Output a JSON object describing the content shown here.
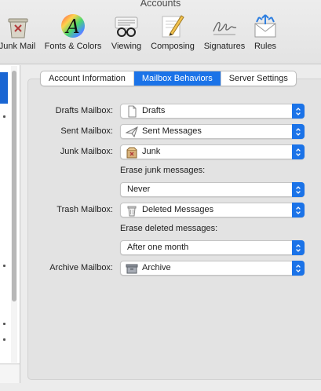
{
  "window": {
    "title": "Accounts"
  },
  "toolbar": {
    "items": [
      {
        "label": "Junk Mail",
        "icon": "junk-mail-icon"
      },
      {
        "label": "Fonts & Colors",
        "icon": "fonts-colors-icon"
      },
      {
        "label": "Viewing",
        "icon": "viewing-glasses-icon"
      },
      {
        "label": "Composing",
        "icon": "composing-pencil-icon"
      },
      {
        "label": "Signatures",
        "icon": "signature-icon"
      },
      {
        "label": "Rules",
        "icon": "rules-envelope-icon"
      }
    ]
  },
  "tabs": [
    {
      "label": "Account Information",
      "active": false
    },
    {
      "label": "Mailbox Behaviors",
      "active": true
    },
    {
      "label": "Server Settings",
      "active": false
    }
  ],
  "form": {
    "drafts": {
      "label": "Drafts Mailbox:",
      "value": "Drafts",
      "icon": "document-icon"
    },
    "sent": {
      "label": "Sent Mailbox:",
      "value": "Sent Messages",
      "icon": "paper-plane-icon"
    },
    "junk": {
      "label": "Junk Mailbox:",
      "value": "Junk",
      "icon": "junk-box-icon"
    },
    "erase_junk": {
      "label": "Erase junk messages:",
      "value": "Never"
    },
    "trash": {
      "label": "Trash Mailbox:",
      "value": "Deleted Messages",
      "icon": "trash-icon"
    },
    "erase_deleted": {
      "label": "Erase deleted messages:",
      "value": "After one month"
    },
    "archive": {
      "label": "Archive Mailbox:",
      "value": "Archive",
      "icon": "archive-box-icon"
    }
  },
  "colors": {
    "accent": "#1b73e8",
    "selection": "#1a66d3"
  }
}
